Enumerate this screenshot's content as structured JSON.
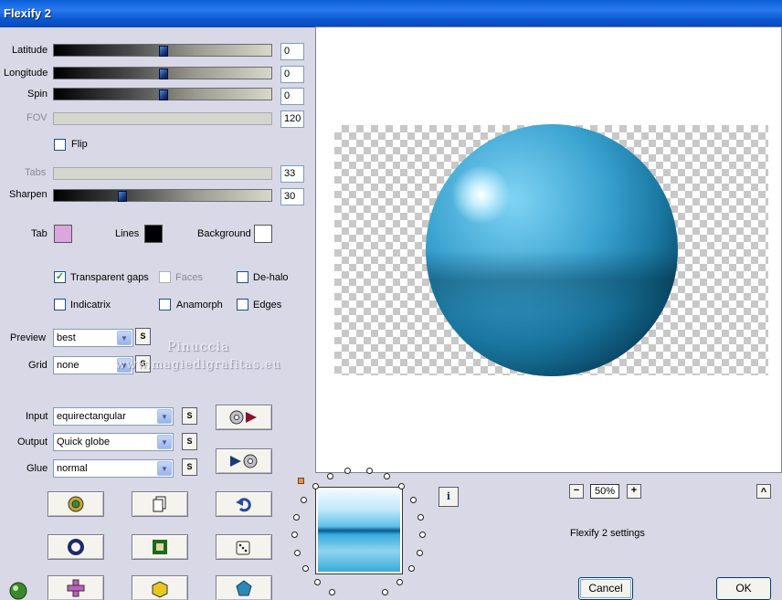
{
  "window": {
    "title": "Flexify 2"
  },
  "params": {
    "latitude": {
      "label": "Latitude",
      "value": "0",
      "position": 0.5
    },
    "longitude": {
      "label": "Longitude",
      "value": "0",
      "position": 0.5
    },
    "spin": {
      "label": "Spin",
      "value": "0",
      "position": 0.5
    },
    "fov": {
      "label": "FOV",
      "value": "120"
    },
    "tabs": {
      "label": "Tabs",
      "value": "33"
    },
    "sharpen": {
      "label": "Sharpen",
      "value": "30",
      "position": 0.3
    }
  },
  "flip": {
    "label": "Flip",
    "checked": false
  },
  "colors": {
    "tab": {
      "label": "Tab",
      "color": "#d9a7de"
    },
    "lines": {
      "label": "Lines",
      "color": "#000000"
    },
    "background": {
      "label": "Background",
      "color": "#ffffff"
    }
  },
  "options": {
    "transparent_gaps": {
      "label": "Transparent gaps",
      "checked": true
    },
    "faces": {
      "label": "Faces",
      "checked": false
    },
    "de_halo": {
      "label": "De-halo",
      "checked": false
    },
    "indicatrix": {
      "label": "Indicatrix",
      "checked": false
    },
    "anamorph": {
      "label": "Anamorph",
      "checked": false
    },
    "edges": {
      "label": "Edges",
      "checked": false
    }
  },
  "selects": {
    "preview": {
      "label": "Preview",
      "value": "best"
    },
    "grid": {
      "label": "Grid",
      "value": "none"
    },
    "input": {
      "label": "Input",
      "value": "equirectangular"
    },
    "output": {
      "label": "Output",
      "value": "Quick globe"
    },
    "glue": {
      "label": "Glue",
      "value": "normal"
    }
  },
  "s_button_label": "S",
  "watermark": {
    "line1": "Pinuccia",
    "line2": "www.magiedigrafitas.eu"
  },
  "zoom": {
    "minus": "−",
    "value": "50%",
    "plus": "+"
  },
  "info_label": "i",
  "up_label": "^",
  "settings_label": "Flexify 2 settings",
  "buttons": {
    "cancel": "Cancel",
    "ok": "OK"
  },
  "accent_colors": {
    "titlebar": "#0a5fd8",
    "checkmark": "#21a121",
    "sphere": "#1b7aa4"
  }
}
